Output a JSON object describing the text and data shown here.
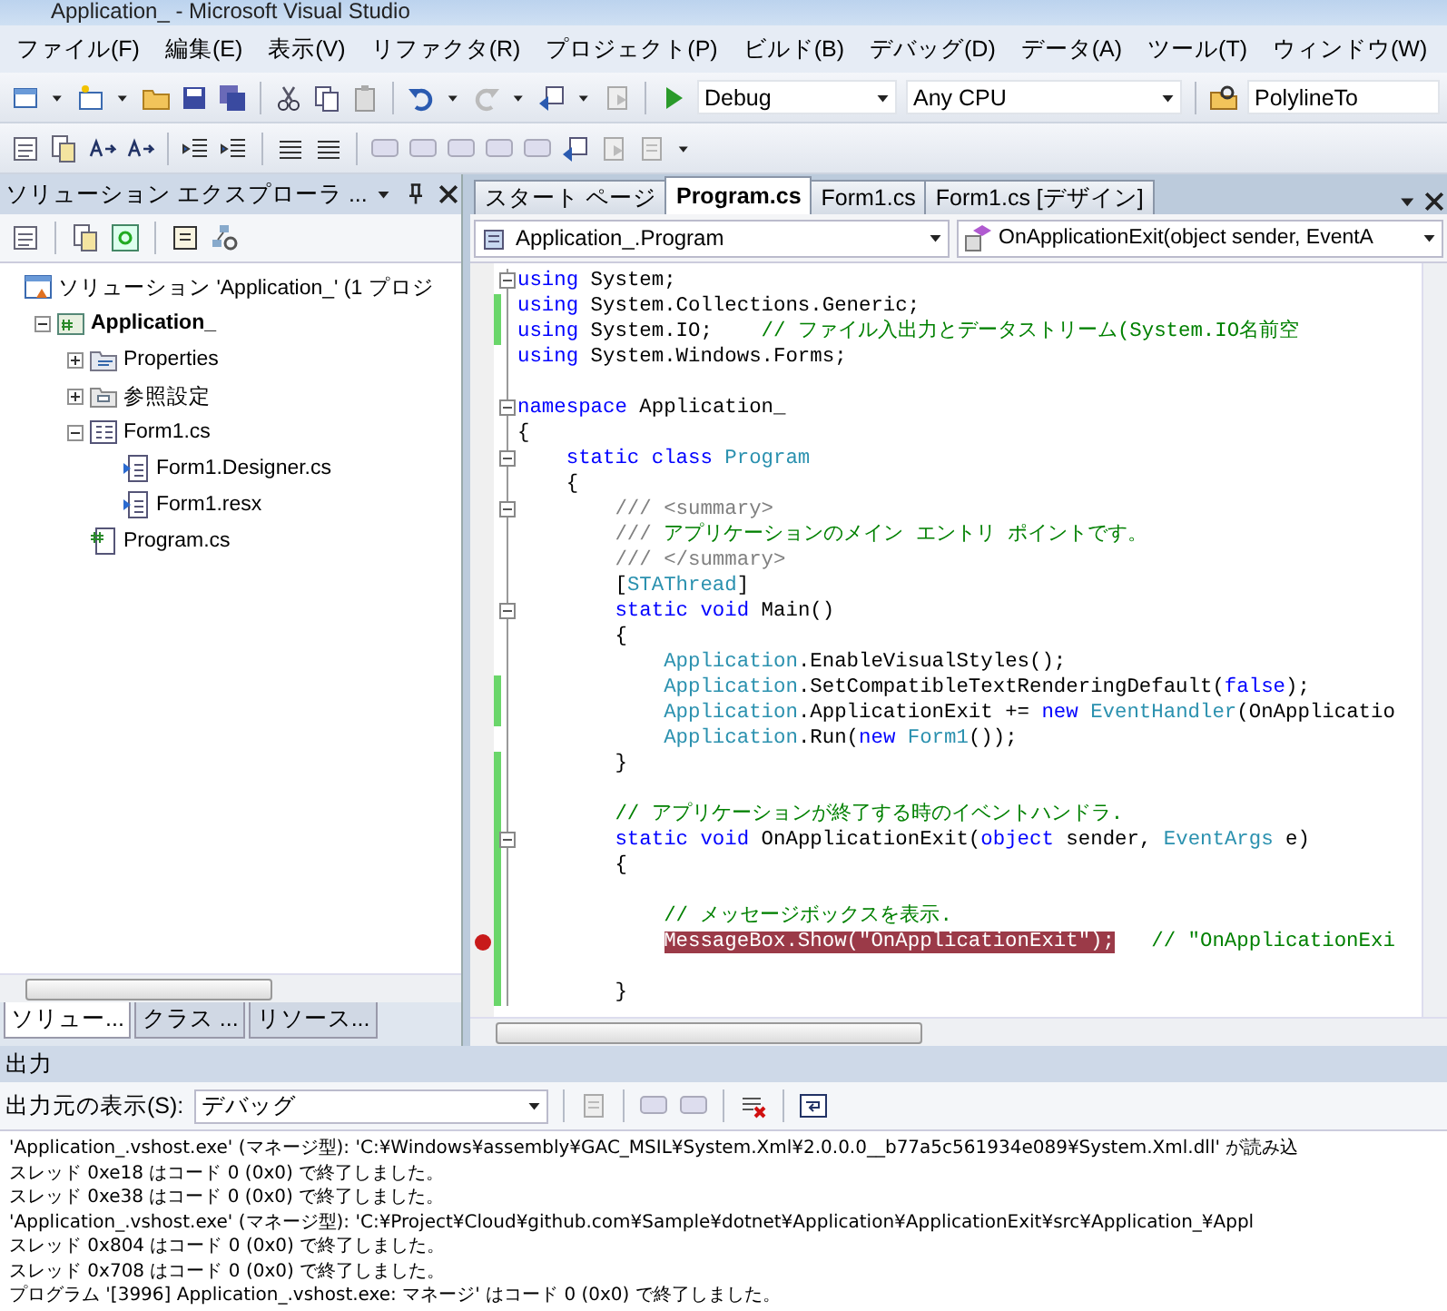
{
  "window": {
    "title": "Application_ - Microsoft Visual Studio"
  },
  "menu": [
    {
      "label": "ファイル(F)"
    },
    {
      "label": "編集(E)"
    },
    {
      "label": "表示(V)"
    },
    {
      "label": "リファクタ(R)"
    },
    {
      "label": "プロジェクト(P)"
    },
    {
      "label": "ビルド(B)"
    },
    {
      "label": "デバッグ(D)"
    },
    {
      "label": "データ(A)"
    },
    {
      "label": "ツール(T)"
    },
    {
      "label": "ウィンドウ(W)"
    }
  ],
  "toolbar": {
    "configuration": "Debug",
    "platform": "Any CPU",
    "find": "PolylineTo"
  },
  "solution_explorer": {
    "title": "ソリューション エクスプローラ ...",
    "tree": [
      {
        "label": "ソリューション 'Application_' (1 プロジ",
        "kind": "solution",
        "children": [
          {
            "label": "Application_",
            "kind": "project",
            "expanded": true,
            "children": [
              {
                "label": "Properties",
                "kind": "properties",
                "expanded": false
              },
              {
                "label": "参照設定",
                "kind": "references",
                "expanded": false
              },
              {
                "label": "Form1.cs",
                "kind": "form",
                "expanded": true,
                "children": [
                  {
                    "label": "Form1.Designer.cs",
                    "kind": "dependent"
                  },
                  {
                    "label": "Form1.resx",
                    "kind": "dependent"
                  }
                ]
              },
              {
                "label": "Program.cs",
                "kind": "csfile"
              }
            ]
          }
        ]
      }
    ],
    "tabs": [
      {
        "label": "ソリュー...",
        "selected": true
      },
      {
        "label": "クラス ...",
        "selected": false
      },
      {
        "label": "リソース...",
        "selected": false
      }
    ]
  },
  "editor": {
    "tabs": [
      {
        "label": "スタート ページ",
        "selected": false
      },
      {
        "label": "Program.cs",
        "selected": true
      },
      {
        "label": "Form1.cs",
        "selected": false
      },
      {
        "label": "Form1.cs [デザイン]",
        "selected": false
      }
    ],
    "type_dropdown": "Application_.Program",
    "member_dropdown": "OnApplicationExit(object sender, EventA",
    "lines": [
      {
        "changed": false,
        "fold_start": true,
        "breakpoint": false,
        "segments": [
          {
            "kind": "keyword",
            "text": "using"
          },
          {
            "kind": "plain",
            "text": " System;"
          }
        ]
      },
      {
        "changed": true,
        "fold_start": false,
        "breakpoint": false,
        "segments": [
          {
            "kind": "keyword",
            "text": "using"
          },
          {
            "kind": "plain",
            "text": " System.Collections.Generic;"
          }
        ]
      },
      {
        "changed": true,
        "fold_start": false,
        "breakpoint": false,
        "segments": [
          {
            "kind": "keyword",
            "text": "using"
          },
          {
            "kind": "plain",
            "text": " System.IO;    "
          },
          {
            "kind": "comment",
            "text": "// ファイル入出力とデータストリーム(System.IO名前空"
          }
        ]
      },
      {
        "changed": false,
        "fold_start": false,
        "breakpoint": false,
        "segments": [
          {
            "kind": "keyword",
            "text": "using"
          },
          {
            "kind": "plain",
            "text": " System.Windows.Forms;"
          }
        ]
      },
      {
        "changed": false,
        "fold_start": false,
        "breakpoint": false
      },
      {
        "changed": false,
        "fold_start": true,
        "breakpoint": false,
        "segments": [
          {
            "kind": "keyword",
            "text": "namespace"
          },
          {
            "kind": "plain",
            "text": " Application_"
          }
        ]
      },
      {
        "changed": false,
        "fold_start": false,
        "breakpoint": false,
        "segments": [
          {
            "kind": "plain",
            "text": "{"
          }
        ]
      },
      {
        "changed": false,
        "fold_start": true,
        "breakpoint": false,
        "segments": [
          {
            "kind": "keyword",
            "text": "    static class "
          },
          {
            "kind": "type",
            "text": "Program"
          }
        ]
      },
      {
        "changed": false,
        "fold_start": false,
        "breakpoint": false,
        "segments": [
          {
            "kind": "plain",
            "text": "    {"
          }
        ]
      },
      {
        "changed": false,
        "fold_start": true,
        "breakpoint": false,
        "segments": [
          {
            "kind": "doc",
            "text": "        /// <summary>"
          }
        ]
      },
      {
        "changed": false,
        "fold_start": false,
        "breakpoint": false,
        "segments": [
          {
            "kind": "doc",
            "text": "        ///"
          },
          {
            "kind": "comment",
            "text": " アプリケーションのメイン エントリ ポイントです。"
          }
        ]
      },
      {
        "changed": false,
        "fold_start": false,
        "breakpoint": false,
        "segments": [
          {
            "kind": "doc",
            "text": "        /// </summary>"
          }
        ]
      },
      {
        "changed": false,
        "fold_start": false,
        "breakpoint": false,
        "segments": [
          {
            "kind": "plain",
            "text": "        ["
          },
          {
            "kind": "type",
            "text": "STAThread"
          },
          {
            "kind": "plain",
            "text": "]"
          }
        ]
      },
      {
        "changed": false,
        "fold_start": true,
        "breakpoint": false,
        "segments": [
          {
            "kind": "keyword",
            "text": "        static void"
          },
          {
            "kind": "plain",
            "text": " Main()"
          }
        ]
      },
      {
        "changed": false,
        "fold_start": false,
        "breakpoint": false,
        "segments": [
          {
            "kind": "plain",
            "text": "        {"
          }
        ]
      },
      {
        "changed": false,
        "fold_start": false,
        "breakpoint": false,
        "segments": [
          {
            "kind": "type",
            "text": "            Application"
          },
          {
            "kind": "plain",
            "text": ".EnableVisualStyles();"
          }
        ]
      },
      {
        "changed": true,
        "fold_start": false,
        "breakpoint": false,
        "segments": [
          {
            "kind": "type",
            "text": "            Application"
          },
          {
            "kind": "plain",
            "text": ".SetCompatibleTextRenderingDefault("
          },
          {
            "kind": "keyword",
            "text": "false"
          },
          {
            "kind": "plain",
            "text": ");"
          }
        ]
      },
      {
        "changed": true,
        "fold_start": false,
        "breakpoint": false,
        "segments": [
          {
            "kind": "type",
            "text": "            Application"
          },
          {
            "kind": "plain",
            "text": ".ApplicationExit += "
          },
          {
            "kind": "keyword",
            "text": "new "
          },
          {
            "kind": "type",
            "text": "EventHandler"
          },
          {
            "kind": "plain",
            "text": "(OnApplicatio"
          }
        ]
      },
      {
        "changed": false,
        "fold_start": false,
        "breakpoint": false,
        "segments": [
          {
            "kind": "type",
            "text": "            Application"
          },
          {
            "kind": "plain",
            "text": ".Run("
          },
          {
            "kind": "keyword",
            "text": "new "
          },
          {
            "kind": "type",
            "text": "Form1"
          },
          {
            "kind": "plain",
            "text": "());"
          }
        ]
      },
      {
        "changed": true,
        "fold_start": false,
        "breakpoint": false,
        "segments": [
          {
            "kind": "plain",
            "text": "        }"
          }
        ]
      },
      {
        "changed": true,
        "fold_start": false,
        "breakpoint": false
      },
      {
        "changed": true,
        "fold_start": false,
        "breakpoint": false,
        "segments": [
          {
            "kind": "comment",
            "text": "        // アプリケーションが終了する時のイベントハンドラ."
          }
        ]
      },
      {
        "changed": true,
        "fold_start": true,
        "breakpoint": false,
        "segments": [
          {
            "kind": "keyword",
            "text": "        static void"
          },
          {
            "kind": "plain",
            "text": " OnApplicationExit("
          },
          {
            "kind": "keyword",
            "text": "object"
          },
          {
            "kind": "plain",
            "text": " sender, "
          },
          {
            "kind": "type",
            "text": "EventArgs"
          },
          {
            "kind": "plain",
            "text": " e)"
          }
        ]
      },
      {
        "changed": true,
        "fold_start": false,
        "breakpoint": false,
        "segments": [
          {
            "kind": "plain",
            "text": "        {"
          }
        ]
      },
      {
        "changed": true,
        "fold_start": false,
        "breakpoint": false
      },
      {
        "changed": true,
        "fold_start": false,
        "breakpoint": false,
        "segments": [
          {
            "kind": "comment",
            "text": "            // メッセージボックスを表示."
          }
        ]
      },
      {
        "changed": true,
        "fold_start": false,
        "breakpoint": true,
        "segments": [
          {
            "kind": "breakpoint",
            "text": "            MessageBox.Show(\"OnApplicationExit\");"
          },
          {
            "kind": "comment",
            "text": "   // \"OnApplicationExi"
          }
        ]
      },
      {
        "changed": true,
        "fold_start": false,
        "breakpoint": false
      },
      {
        "changed": true,
        "fold_start": false,
        "breakpoint": false,
        "segments": [
          {
            "kind": "plain",
            "text": "        }"
          }
        ]
      }
    ]
  },
  "output": {
    "title": "出力",
    "source_label": "出力元の表示(S):",
    "source": "デバッグ",
    "lines": [
      "'Application_.vshost.exe' (マネージ型): 'C:¥Windows¥assembly¥GAC_MSIL¥System.Xml¥2.0.0.0__b77a5c561934e089¥System.Xml.dll' が読み込",
      "スレッド 0xe18 はコード 0 (0x0) で終了しました。",
      "スレッド 0xe38 はコード 0 (0x0) で終了しました。",
      "'Application_.vshost.exe' (マネージ型): 'C:¥Project¥Cloud¥github.com¥Sample¥dotnet¥Application¥ApplicationExit¥src¥Application_¥Appl",
      "スレッド 0x804 はコード 0 (0x0) で終了しました。",
      "スレッド 0x708 はコード 0 (0x0) で終了しました。",
      "プログラム '[3996] Application_.vshost.exe: マネージ' はコード 0 (0x0) で終了しました。"
    ]
  }
}
